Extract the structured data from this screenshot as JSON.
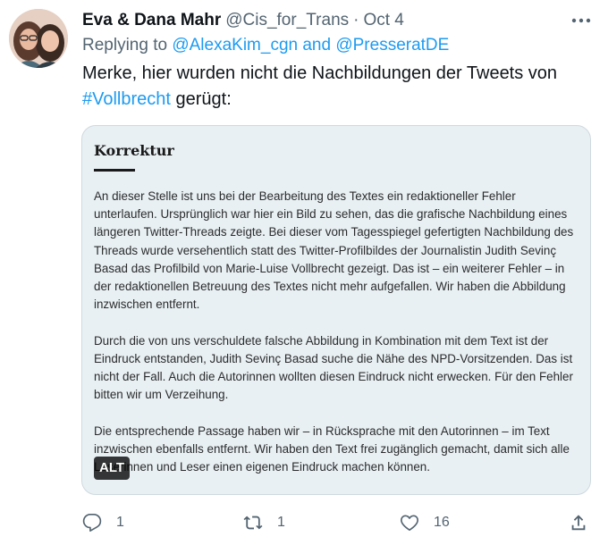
{
  "tweet": {
    "display_name": "Eva & Dana Mahr",
    "handle": "@Cis_for_Trans",
    "separator": "·",
    "date": "Oct 4",
    "reply_prefix": "Replying to",
    "reply_mentions": "@AlexaKim_cgn and @PresseratDE",
    "text_before": "Merke, hier wurden nicht die Nachbildungen der Tweets von ",
    "hashtag": "#Vollbrecht",
    "text_after": " gerügt:"
  },
  "media": {
    "title": "Korrektur",
    "paragraphs": [
      "An dieser Stelle ist uns bei der Bearbeitung des Textes ein redaktioneller Fehler unterlaufen. Ursprünglich war hier ein Bild zu sehen, das die grafische Nachbildung eines längeren Twitter-Threads zeigte. Bei dieser vom Tagesspiegel gefertigten Nachbildung des Threads wurde versehentlich statt des Twitter-Profilbildes der Journalistin Judith Sevinç Basad das Profilbild von Marie-Luise Vollbrecht gezeigt. Das ist – ein weiterer Fehler – in der redaktionellen Betreuung des Textes nicht mehr aufgefallen. Wir haben die Abbildung inzwischen entfernt.",
      "Durch die von uns verschuldete falsche Abbildung in Kombination mit dem Text ist der Eindruck entstanden, Judith Sevinç Basad suche die Nähe des NPD-Vorsitzenden. Das ist nicht der Fall. Auch die Autorinnen wollten diesen Eindruck nicht erwecken. Für den Fehler bitten wir um Verzeihung.",
      "Die entsprechende Passage haben wir – in Rücksprache mit den Autorinnen – im Text inzwischen ebenfalls entfernt. Wir haben den Text frei zugänglich gemacht, damit sich alle Leserinnen und Leser einen eigenen Eindruck machen können."
    ],
    "alt_badge": "ALT"
  },
  "actions": {
    "reply_count": "1",
    "retweet_count": "1",
    "like_count": "16"
  },
  "icons": {
    "more": "more-horizontal-icon",
    "reply": "reply-bubble-icon",
    "retweet": "retweet-icon",
    "like": "heart-icon",
    "share": "share-icon"
  },
  "colors": {
    "link": "#1d9bf0",
    "secondary_text": "#536471",
    "card_background": "#e8f0f4"
  }
}
